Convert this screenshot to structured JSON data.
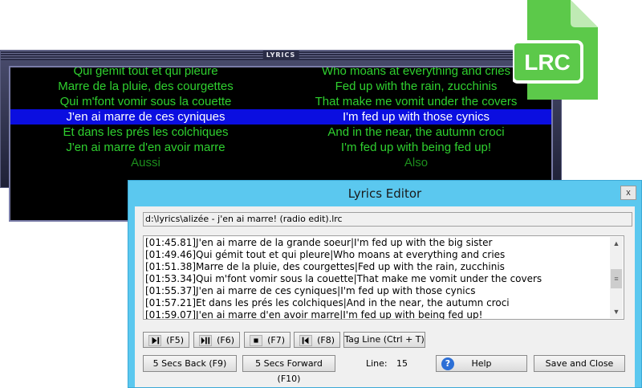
{
  "lyrics_window": {
    "title": "LYRICS",
    "rows": [
      {
        "fr": "Qui gémit tout et qui pleure",
        "en": "Who moans at everything and cries",
        "state": "normal"
      },
      {
        "fr": "Marre de la pluie, des courgettes",
        "en": "Fed up with the rain, zucchinis",
        "state": "normal"
      },
      {
        "fr": "Qui m'font vomir sous la couette",
        "en": "That make me vomit under the covers",
        "state": "normal"
      },
      {
        "fr": "J'en ai marre de ces cyniques",
        "en": "I'm fed up with those cynics",
        "state": "active"
      },
      {
        "fr": "Et dans les prés les colchiques",
        "en": "And in the near, the autumn croci",
        "state": "normal"
      },
      {
        "fr": "J'en ai marre d'en avoir marre",
        "en": "I'm fed up with being fed up!",
        "state": "normal"
      },
      {
        "fr": "Aussi",
        "en": "Also",
        "state": "dim"
      }
    ],
    "colors": {
      "text": "#2fd02f",
      "highlight_bg": "#0b0ee0",
      "highlight_text": "#ffffff"
    }
  },
  "file_icon": {
    "label": "LRC",
    "color": "#5cc94a"
  },
  "editor": {
    "title": "Lyrics Editor",
    "close_label": "x",
    "file_path": "d:\\lyrics\\alizée - j'en ai marre! (radio edit).lrc",
    "lines": [
      "[01:45.81]J'en ai marre de la grande soeur|I'm fed up with the big sister",
      "[01:49.46]Qui gémit tout et qui pleure|Who moans at everything and cries",
      "[01:51.38]Marre de la pluie, des courgettes|Fed up with the rain, zucchinis",
      "[01:53.34]Qui m'font vomir sous la couette|That make me vomit under the covers",
      "[01:55.37]J'en ai marre de ces cyniques|I'm fed up with those cynics",
      "[01:57.21]Et dans les prés les colchiques|And in the near, the autumn croci",
      "[01:59.07]J'en ai marre d'en avoir marre|I'm fed up with being fed up!"
    ],
    "buttons": {
      "play": {
        "icon": "play-icon",
        "key": "(F5)"
      },
      "play_pause": {
        "icon": "play-pause-icon",
        "key": "(F6)"
      },
      "stop": {
        "icon": "stop-icon",
        "key": "(F7)"
      },
      "back": {
        "icon": "skip-back-icon",
        "key": "(F8)"
      },
      "tag_line": "Tag Line (Ctrl + T)",
      "back5": "5 Secs Back (F9)",
      "fwd5": "5 Secs Forward (F10)",
      "help": "Help",
      "save_close": "Save and Close"
    },
    "line_label": "Line:",
    "line_value": "15",
    "title_bar_color": "#5bc8ef"
  }
}
